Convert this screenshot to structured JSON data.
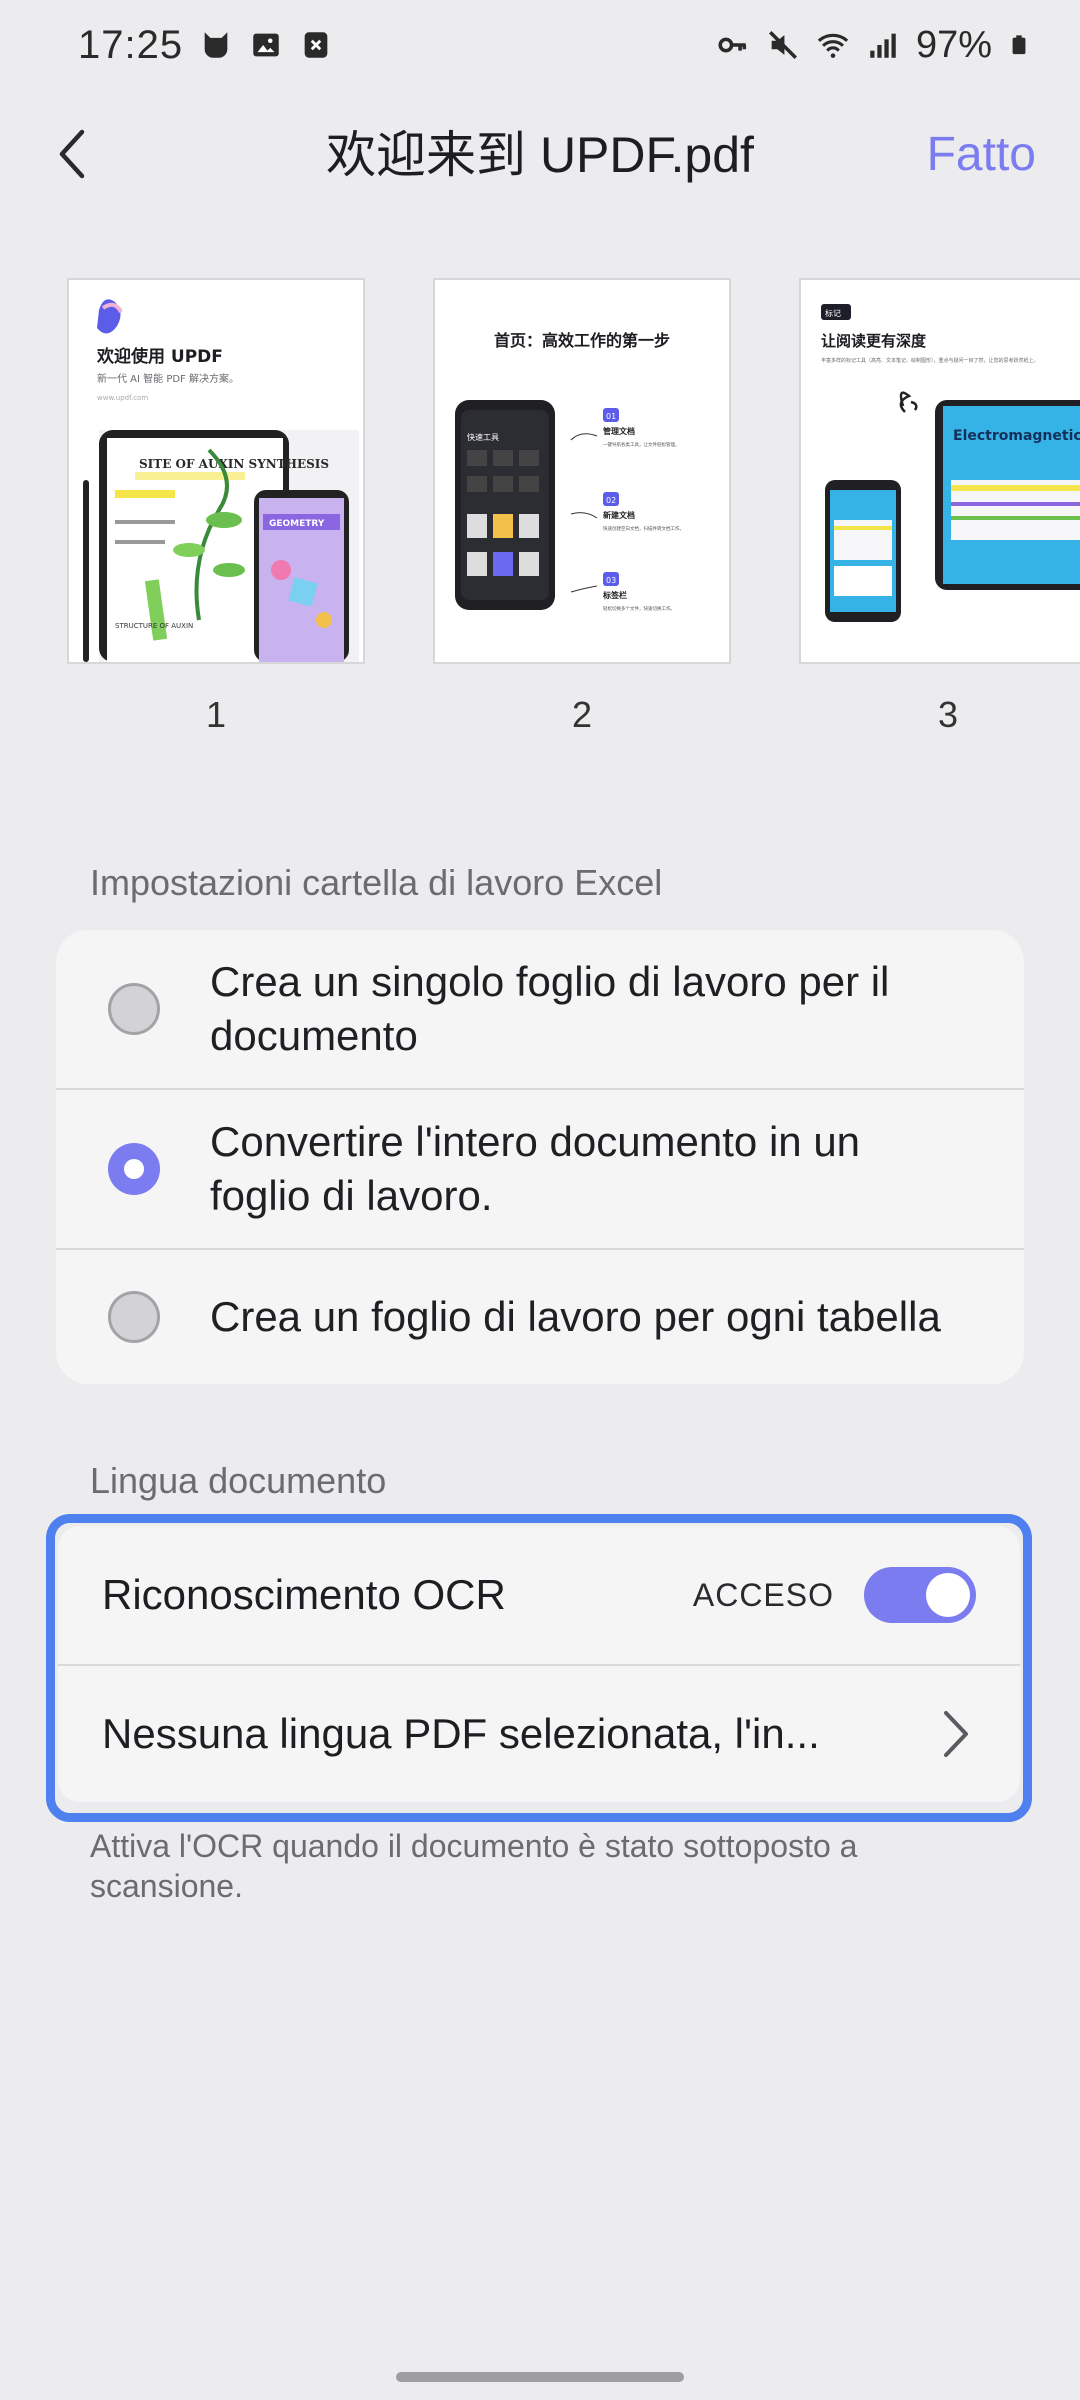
{
  "status_bar": {
    "time": "17:25",
    "battery": "97%",
    "icons": [
      "cat-icon",
      "image-icon",
      "close-box-icon",
      "key-icon",
      "mute-icon",
      "wifi-icon",
      "signal-icon",
      "battery-icon"
    ]
  },
  "header": {
    "title": "欢迎来到 UPDF.pdf",
    "done_label": "Fatto",
    "accent": "#7b7cf0"
  },
  "thumbnails": [
    {
      "number": "1",
      "title": "欢迎使用 UPDF",
      "subtitle": "新一代 AI 智能 PDF 解决方案。",
      "url": "www.updf.com",
      "inner_title": "SITE OF AUXIN SYNTHESIS",
      "inner_title_2": "GEOMETRY",
      "inner_caption": "STRUCTURE OF AUXIN"
    },
    {
      "number": "2",
      "title": "首页：高效工作的第一步",
      "phone_label": "快速工具",
      "steps": [
        {
          "num": "01",
          "title": "管理文档",
          "desc": "一键导航各类工具，让文件轻松管理。"
        },
        {
          "num": "02",
          "title": "新建文档",
          "desc": "快速创建空白文档，扫描件转文档工作。"
        },
        {
          "num": "03",
          "title": "标签栏",
          "desc": "轻松切换多个文件，快速切换工作。"
        }
      ]
    },
    {
      "number": "3",
      "tag": "标记",
      "title": "让阅读更有深度",
      "subtitle": "丰富多样的标记工具（高亮、文本笔记、绘制图形），重点与疑问一目了然，让您的思考跃然纸上。",
      "inner_title": "Electromagnetic Spectrum"
    }
  ],
  "excel_settings": {
    "label": "Impostazioni cartella di lavoro Excel",
    "options": [
      {
        "label_line1": "Crea un singolo foglio di lavoro per il",
        "label_line2": "documento",
        "selected": false
      },
      {
        "label_line1": "Convertire l'intero documento in un",
        "label_line2": "foglio di lavoro.",
        "selected": true
      },
      {
        "label_line1": "Crea un foglio di lavoro per ogni tabella",
        "label_line2": "",
        "selected": false
      }
    ]
  },
  "language": {
    "label": "Lingua documento",
    "ocr_label": "Riconoscimento OCR",
    "ocr_status": "ACCESO",
    "ocr_enabled": true,
    "language_value": "Nessuna lingua PDF selezionata, l'in...",
    "help_text": "Attiva l'OCR quando il documento è stato sottoposto a scansione."
  }
}
